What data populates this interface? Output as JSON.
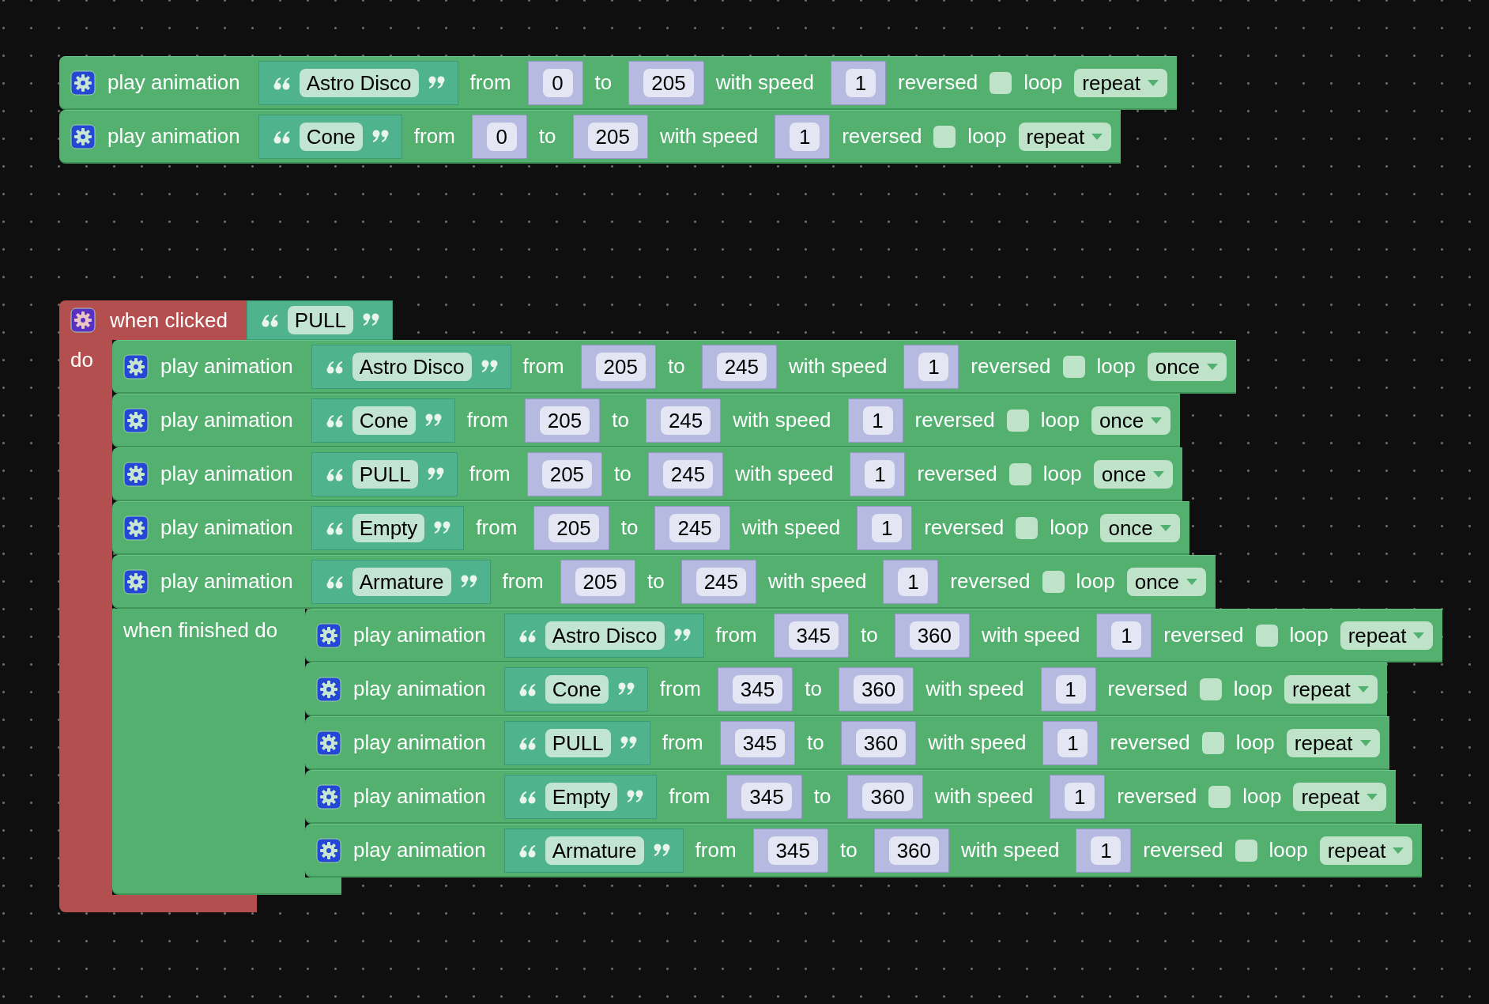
{
  "stacks": [
    {
      "kind": "sequence",
      "blocks": [
        {
          "kind": "play_animation",
          "label": "play animation",
          "animation": "Astro Disco",
          "from_label": "from",
          "from": "0",
          "to_label": "to",
          "to": "205",
          "speed_label": "with speed",
          "speed": "1",
          "reversed_label": "reversed",
          "reversed": false,
          "loop_label": "loop",
          "loop": "repeat"
        },
        {
          "kind": "play_animation",
          "label": "play animation",
          "animation": "Cone",
          "from_label": "from",
          "from": "0",
          "to_label": "to",
          "to": "205",
          "speed_label": "with speed",
          "speed": "1",
          "reversed_label": "reversed",
          "reversed": false,
          "loop_label": "loop",
          "loop": "repeat"
        }
      ]
    },
    {
      "kind": "event",
      "label": "when clicked",
      "target": "PULL",
      "do_label": "do",
      "blocks": [
        {
          "kind": "play_animation",
          "label": "play animation",
          "animation": "Astro Disco",
          "from_label": "from",
          "from": "205",
          "to_label": "to",
          "to": "245",
          "speed_label": "with speed",
          "speed": "1",
          "reversed_label": "reversed",
          "reversed": false,
          "loop_label": "loop",
          "loop": "once"
        },
        {
          "kind": "play_animation",
          "label": "play animation",
          "animation": "Cone",
          "from_label": "from",
          "from": "205",
          "to_label": "to",
          "to": "245",
          "speed_label": "with speed",
          "speed": "1",
          "reversed_label": "reversed",
          "reversed": false,
          "loop_label": "loop",
          "loop": "once"
        },
        {
          "kind": "play_animation",
          "label": "play animation",
          "animation": "PULL",
          "from_label": "from",
          "from": "205",
          "to_label": "to",
          "to": "245",
          "speed_label": "with speed",
          "speed": "1",
          "reversed_label": "reversed",
          "reversed": false,
          "loop_label": "loop",
          "loop": "once"
        },
        {
          "kind": "play_animation",
          "label": "play animation",
          "animation": "Empty",
          "from_label": "from",
          "from": "205",
          "to_label": "to",
          "to": "245",
          "speed_label": "with speed",
          "speed": "1",
          "reversed_label": "reversed",
          "reversed": false,
          "loop_label": "loop",
          "loop": "once"
        },
        {
          "kind": "play_animation",
          "label": "play animation",
          "animation": "Armature",
          "from_label": "from",
          "from": "205",
          "to_label": "to",
          "to": "245",
          "speed_label": "with speed",
          "speed": "1",
          "reversed_label": "reversed",
          "reversed": false,
          "loop_label": "loop",
          "loop": "once",
          "finished_label": "when finished do",
          "finished": [
            {
              "kind": "play_animation",
              "label": "play animation",
              "animation": "Astro Disco",
              "from_label": "from",
              "from": "345",
              "to_label": "to",
              "to": "360",
              "speed_label": "with speed",
              "speed": "1",
              "reversed_label": "reversed",
              "reversed": false,
              "loop_label": "loop",
              "loop": "repeat"
            },
            {
              "kind": "play_animation",
              "label": "play animation",
              "animation": "Cone",
              "from_label": "from",
              "from": "345",
              "to_label": "to",
              "to": "360",
              "speed_label": "with speed",
              "speed": "1",
              "reversed_label": "reversed",
              "reversed": false,
              "loop_label": "loop",
              "loop": "repeat"
            },
            {
              "kind": "play_animation",
              "label": "play animation",
              "animation": "PULL",
              "from_label": "from",
              "from": "345",
              "to_label": "to",
              "to": "360",
              "speed_label": "with speed",
              "speed": "1",
              "reversed_label": "reversed",
              "reversed": false,
              "loop_label": "loop",
              "loop": "repeat"
            },
            {
              "kind": "play_animation",
              "label": "play animation",
              "animation": "Empty",
              "from_label": "from",
              "from": "345",
              "to_label": "to",
              "to": "360",
              "speed_label": "with speed",
              "speed": "1",
              "reversed_label": "reversed",
              "reversed": false,
              "loop_label": "loop",
              "loop": "repeat"
            },
            {
              "kind": "play_animation",
              "label": "play animation",
              "animation": "Armature",
              "from_label": "from",
              "from": "345",
              "to_label": "to",
              "to": "360",
              "speed_label": "with speed",
              "speed": "1",
              "reversed_label": "reversed",
              "reversed": false,
              "loop_label": "loop",
              "loop": "repeat"
            }
          ]
        }
      ]
    }
  ]
}
